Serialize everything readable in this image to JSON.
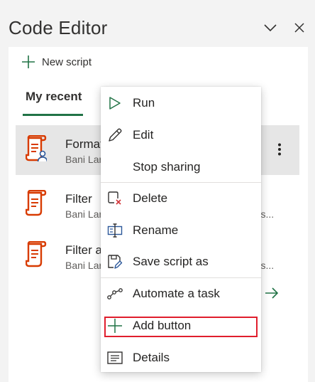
{
  "title": "Code Editor",
  "window_controls": {
    "collapse_icon": "chevron-down-icon",
    "close_icon": "close-icon"
  },
  "colors": {
    "accent": "#217346",
    "script_icon": "#d83b01",
    "highlight": "#e01e2d"
  },
  "toolbar": {
    "new_script_label": "New script",
    "new_script_icon": "plus-icon"
  },
  "tabs": [
    {
      "label": "My recent",
      "selected": true
    }
  ],
  "scripts": [
    {
      "name": "Format",
      "owner": "Bani Lar",
      "shared": true,
      "selected": true,
      "more_icon": "vertical-ellipsis-icon"
    },
    {
      "name": "Filter",
      "owner": "Bani Lar",
      "location": "ents...",
      "shared": false
    },
    {
      "name": "Filter a",
      "owner": "Bani Lar",
      "location": "ents...",
      "shared": false
    }
  ],
  "context_menu": {
    "items": [
      {
        "label": "Run",
        "icon": "play-icon"
      },
      {
        "label": "Edit",
        "icon": "pencil-icon"
      },
      {
        "label": "Stop sharing",
        "icon": ""
      },
      {
        "label": "Delete",
        "icon": "delete-document-icon"
      },
      {
        "label": "Rename",
        "icon": "rename-icon"
      },
      {
        "label": "Save script as",
        "icon": "save-as-icon"
      },
      {
        "label": "Automate a task",
        "icon": "flow-icon"
      },
      {
        "label": "Add button",
        "icon": "plus-icon",
        "highlighted": true
      },
      {
        "label": "Details",
        "icon": "details-icon"
      }
    ]
  },
  "footer_arrow_icon": "arrow-right-icon"
}
